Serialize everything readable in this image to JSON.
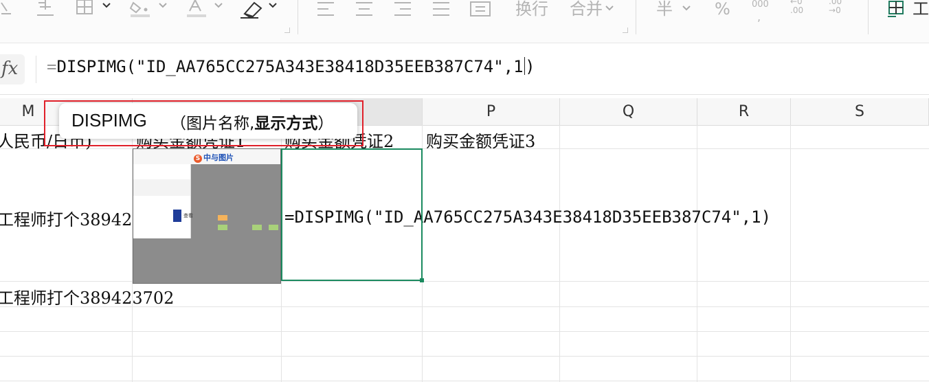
{
  "ribbon": {
    "wrap_text_label": "换行",
    "merge_label": "合并",
    "currency_icon_text": "半",
    "percent_icon_text": "%",
    "comma_icon_text": "000",
    "increase_decimal_text": ".00",
    "decrease_decimal_text": "0",
    "right_cut_text": "工"
  },
  "formula_bar": {
    "fx_label": "fx",
    "equals_sign": "=",
    "formula_text": "DISPIMG(\"ID_AA765CC275A343E38418D35EEB387C74\",1"
  },
  "columns": {
    "M": "M",
    "P": "P",
    "Q": "Q",
    "R": "R",
    "S": "S"
  },
  "cells": {
    "row1_m": "人民币/日币)",
    "row1_n": "购买金额凭证1",
    "row1_o": "购买金额凭证2",
    "row1_p": "购买金额凭证3",
    "row2_m": "工程师打个38942",
    "row2_o_formula": "=DISPIMG(\"ID_AA765CC275A343E38418D35EEB387C74\",1)",
    "row3_m": "工程师打个389423702"
  },
  "tooltip": {
    "function_name": "DISPIMG",
    "args_open": "（图片名称,",
    "args_bold": "显示方式",
    "args_close": "）"
  },
  "thumbnail": {
    "logo_text": "中与图片",
    "btn_text": "查看"
  }
}
